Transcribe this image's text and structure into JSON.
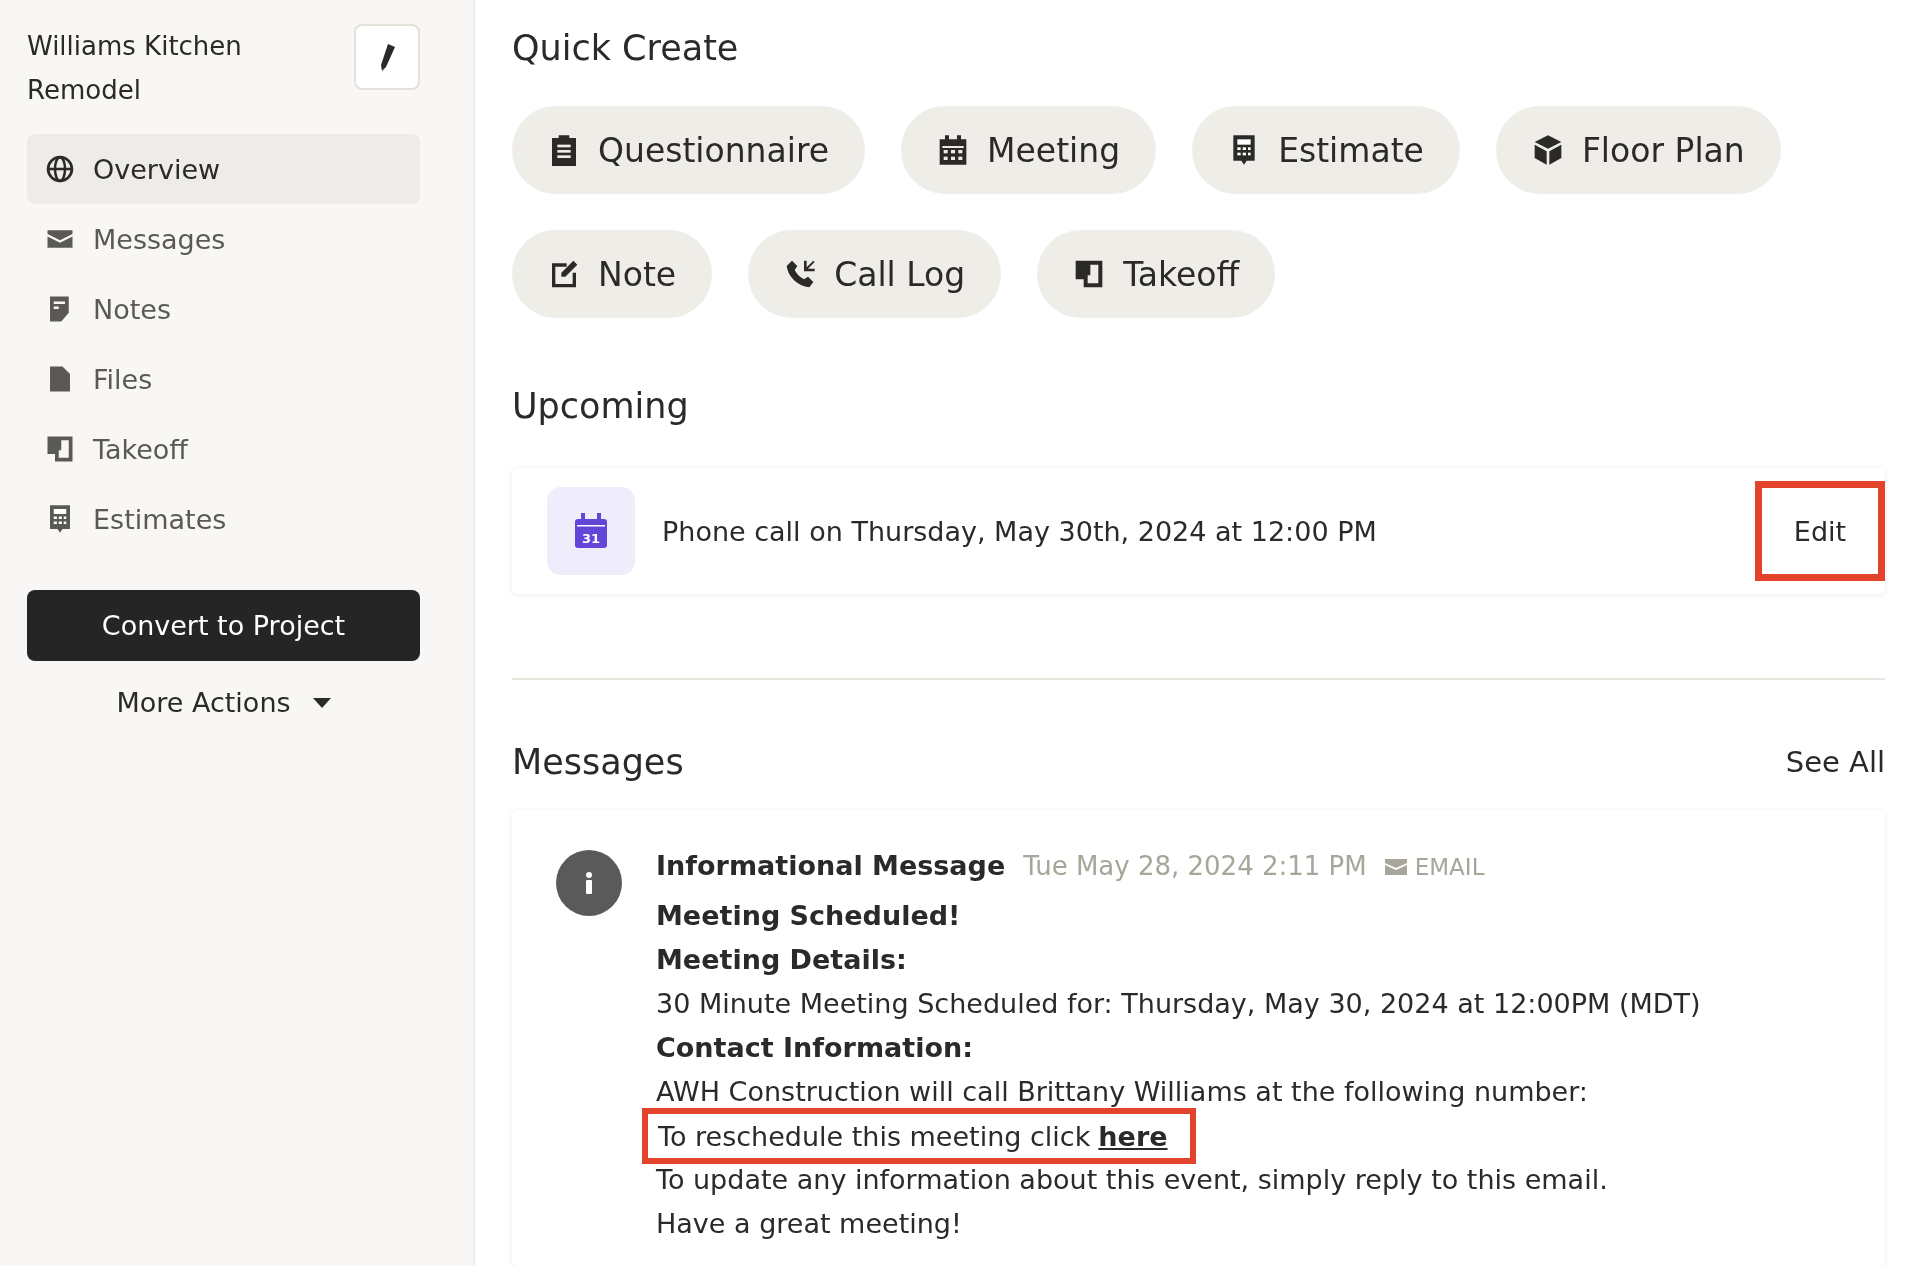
{
  "sidebar": {
    "title": "Williams Kitchen Remodel",
    "items": [
      {
        "label": "Overview",
        "kind": "globe",
        "selected": true
      },
      {
        "label": "Messages",
        "kind": "envelope",
        "selected": false
      },
      {
        "label": "Notes",
        "kind": "note",
        "selected": false
      },
      {
        "label": "Files",
        "kind": "file",
        "selected": false
      },
      {
        "label": "Takeoff",
        "kind": "takeoff",
        "selected": false
      },
      {
        "label": "Estimates",
        "kind": "calculator",
        "selected": false
      }
    ],
    "primary_button": "Convert to Project",
    "more_actions": "More Actions"
  },
  "quick_create": {
    "title": "Quick Create",
    "buttons": [
      {
        "label": "Questionnaire",
        "kind": "clipboard"
      },
      {
        "label": "Meeting",
        "kind": "calendar"
      },
      {
        "label": "Estimate",
        "kind": "calculator"
      },
      {
        "label": "Floor Plan",
        "kind": "cube"
      },
      {
        "label": "Note",
        "kind": "edit"
      },
      {
        "label": "Call Log",
        "kind": "phone"
      },
      {
        "label": "Takeoff",
        "kind": "takeoff"
      }
    ]
  },
  "upcoming": {
    "title": "Upcoming",
    "event": {
      "day": "31",
      "text": "Phone call on Thursday, May 30th, 2024 at 12:00 PM",
      "edit": "Edit",
      "edit_highlighted": true
    }
  },
  "messages": {
    "title": "Messages",
    "see_all": "See All",
    "message": {
      "sender": "Informational Message",
      "time": "Tue May 28, 2024 2:11 PM",
      "channel": "EMAIL",
      "lines": [
        {
          "kind": "heading",
          "text": "Meeting Scheduled!"
        },
        {
          "kind": "heading",
          "text": "Meeting Details:"
        },
        {
          "kind": "plain",
          "text": "30 Minute Meeting Scheduled for: Thursday, May 30, 2024 at 12:00PM (MDT)"
        },
        {
          "kind": "heading",
          "text": "Contact Information:"
        },
        {
          "kind": "plain",
          "text": "AWH Construction will call Brittany Williams at the following number:"
        },
        {
          "kind": "link",
          "text": "To reschedule this meeting click",
          "link": "here",
          "highlighted": true
        },
        {
          "kind": "plain",
          "text": "To update any information about this event, simply reply to this email."
        },
        {
          "kind": "plain",
          "text": "Have a great meeting!"
        }
      ]
    }
  }
}
